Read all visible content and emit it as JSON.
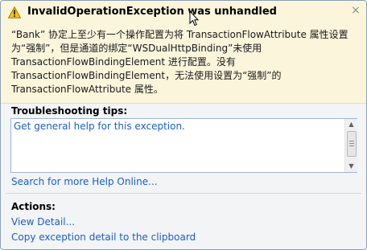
{
  "dialog": {
    "title": "InvalidOperationException was unhandled",
    "close_glyph": "×",
    "message": "“Bank” 协定上至少有一个操作配置为将 TransactionFlowAttribute 属性设置为“强制”，但是通道的绑定“WSDualHttpBinding”未使用 TransactionFlowBindingElement 进行配置。没有 TransactionFlowBindingElement，无法使用设置为“强制”的 TransactionFlowAttribute 属性。",
    "icons": {
      "title": "warning-icon",
      "close": "close-icon"
    }
  },
  "troubleshooting": {
    "heading": "Troubleshooting tips:",
    "tips": [
      "Get general help for this exception."
    ],
    "search_link": "Search for more Help Online..."
  },
  "actions": {
    "heading": "Actions:",
    "items": [
      "View Detail...",
      "Copy exception detail to the clipboard"
    ]
  }
}
